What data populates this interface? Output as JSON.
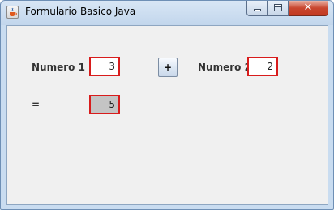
{
  "window": {
    "title": "Formulario Basico Java",
    "close_symbol": "✕"
  },
  "form": {
    "numero1_label": "Numero 1",
    "numero1_value": "3",
    "operator_label": "+",
    "numero2_label": "Numero 2",
    "numero2_value": "2",
    "result_label": "=",
    "result_value": "5"
  },
  "colors": {
    "field_border": "#d81c1c",
    "result_background": "#c4c4c4",
    "content_background": "#f0f0f0"
  }
}
